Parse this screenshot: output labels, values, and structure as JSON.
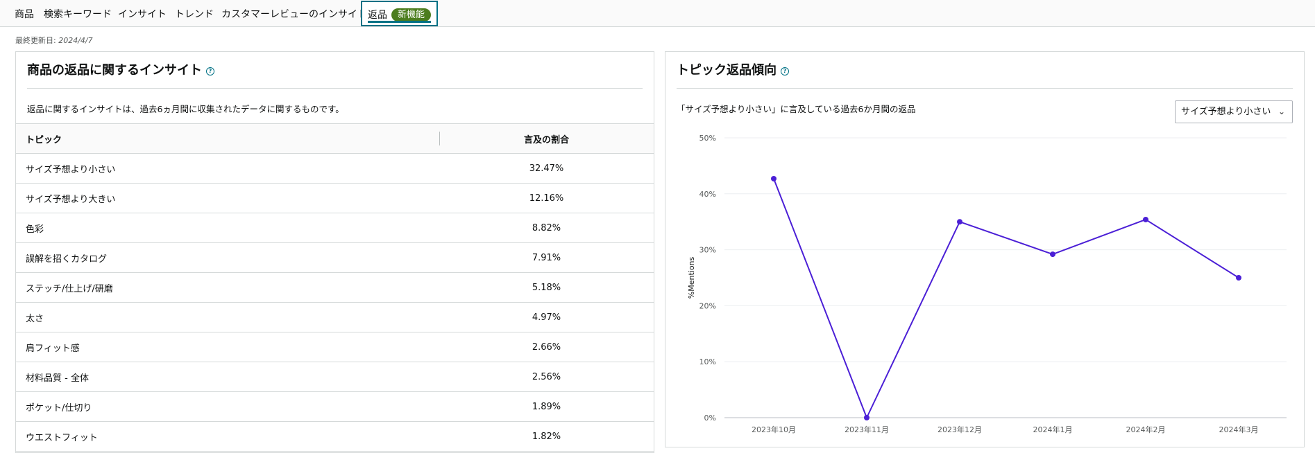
{
  "nav": {
    "tabs": [
      {
        "label": "商品"
      },
      {
        "label": "検索キーワード"
      },
      {
        "label": "インサイト"
      },
      {
        "label": "トレンド"
      },
      {
        "label": "カスタマーレビューのインサイト"
      },
      {
        "label": "返品",
        "badge": "新機能",
        "active": true
      }
    ]
  },
  "updated": {
    "label": "最終更新日:",
    "date": "2024/4/7"
  },
  "left_panel": {
    "title": "商品の返品に関するインサイト",
    "description": "返品に関するインサイトは、過去6ヵ月間に収集されたデータに関するものです。",
    "columns": [
      "トピック",
      "言及の割合"
    ],
    "rows": [
      {
        "topic": "サイズ予想より小さい",
        "pct": "32.47%"
      },
      {
        "topic": "サイズ予想より大きい",
        "pct": "12.16%"
      },
      {
        "topic": "色彩",
        "pct": "8.82%"
      },
      {
        "topic": "誤解を招くカタログ",
        "pct": "7.91%"
      },
      {
        "topic": "ステッチ/仕上げ/研磨",
        "pct": "5.18%"
      },
      {
        "topic": "太さ",
        "pct": "4.97%"
      },
      {
        "topic": "肩フィット感",
        "pct": "2.66%"
      },
      {
        "topic": "材料品質 - 全体",
        "pct": "2.56%"
      },
      {
        "topic": "ポケット/仕切り",
        "pct": "1.89%"
      },
      {
        "topic": "ウエストフィット",
        "pct": "1.82%"
      }
    ]
  },
  "right_panel": {
    "title": "トピック返品傾向",
    "description": "「サイズ予想より小さい」に言及している過去6か月間の返品",
    "select_value": "サイズ予想より小さい"
  },
  "colors": {
    "accent": "#007185",
    "badge": "#4c7d1e",
    "series": "#4b1fd6"
  },
  "chart_data": {
    "type": "line",
    "categories": [
      "2023年10月",
      "2023年11月",
      "2023年12月",
      "2024年1月",
      "2024年2月",
      "2024年3月"
    ],
    "series": [
      {
        "values": [
          42.7,
          0,
          35.0,
          29.2,
          35.4,
          25.0
        ]
      }
    ],
    "ylabel": "%Mentions",
    "ylim": [
      0,
      50
    ],
    "yticks": [
      "0%",
      "10%",
      "20%",
      "30%",
      "40%",
      "50%"
    ],
    "grid": true
  }
}
